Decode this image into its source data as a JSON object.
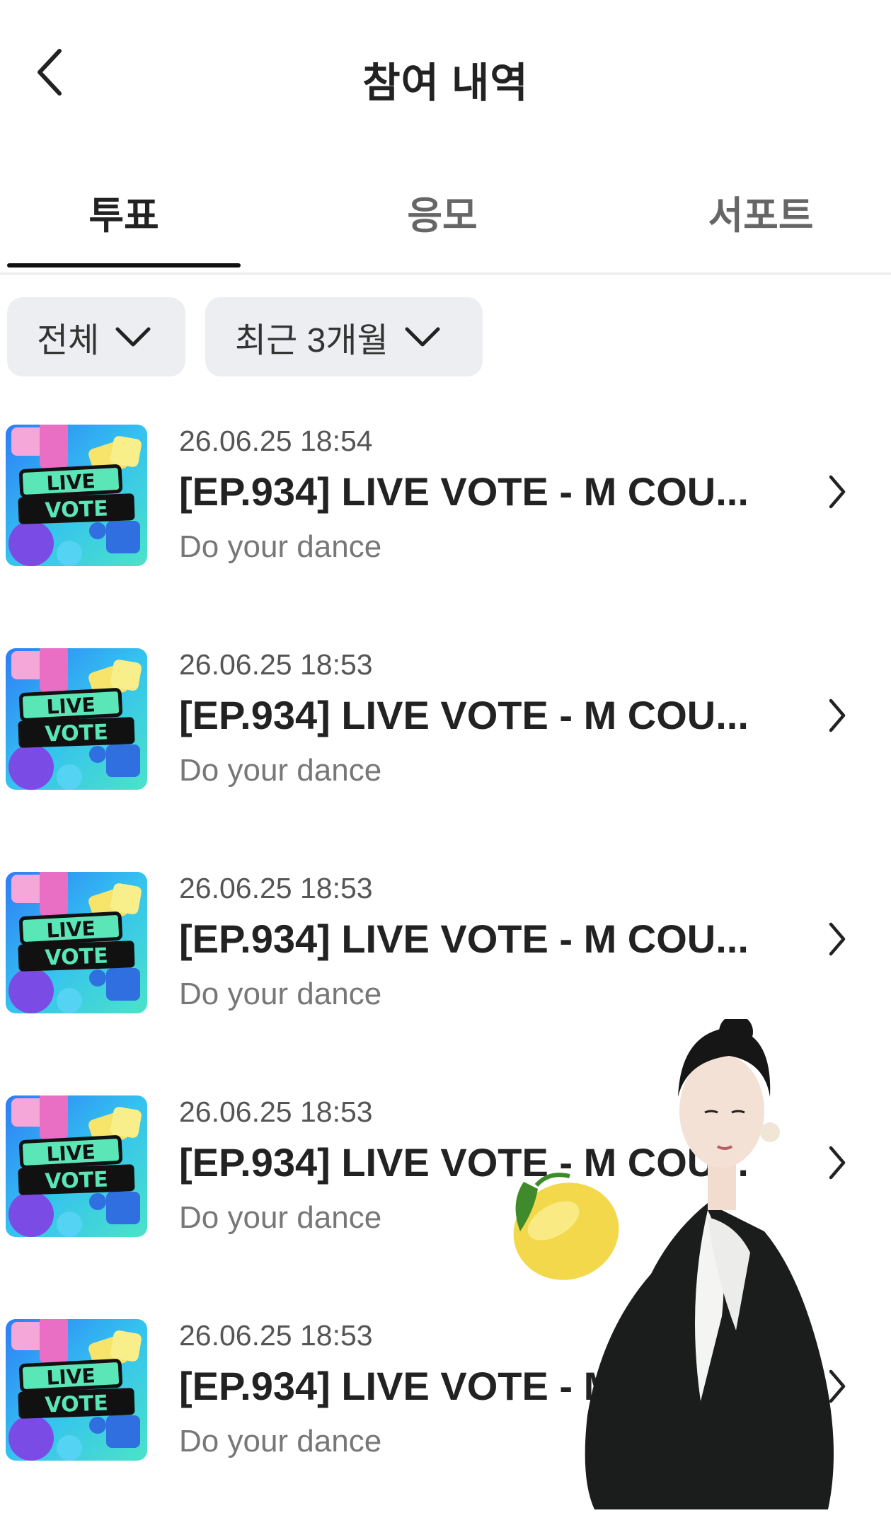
{
  "header": {
    "title": "참여 내역",
    "back_icon": "chevron-left-icon"
  },
  "tabs": [
    {
      "label": "투표",
      "active": true
    },
    {
      "label": "응모",
      "active": false
    },
    {
      "label": "서포트",
      "active": false
    }
  ],
  "filters": [
    {
      "label": "전체",
      "icon": "chevron-down-icon"
    },
    {
      "label": "최근 3개월",
      "icon": "chevron-down-icon"
    }
  ],
  "items": [
    {
      "date": "26.06.25 18:54",
      "title": "[EP.934] LIVE VOTE - M COU...",
      "subtitle": "Do your dance"
    },
    {
      "date": "26.06.25 18:53",
      "title": "[EP.934] LIVE VOTE - M COU...",
      "subtitle": "Do your dance"
    },
    {
      "date": "26.06.25 18:53",
      "title": "[EP.934] LIVE VOTE - M COU...",
      "subtitle": "Do your dance"
    },
    {
      "date": "26.06.25 18:53",
      "title": "[EP.934] LIVE VOTE - M COU...",
      "subtitle": "Do your dance"
    },
    {
      "date": "26.06.25 18:53",
      "title": "[EP.934] LIVE VOTE - M COU...",
      "subtitle": "Do your dance"
    }
  ],
  "thumbnail": {
    "line1": "LIVE",
    "line2": "VOTE"
  },
  "colors": {
    "accent": "#111111",
    "chip_bg": "#eceef2",
    "divider": "#ececef"
  }
}
